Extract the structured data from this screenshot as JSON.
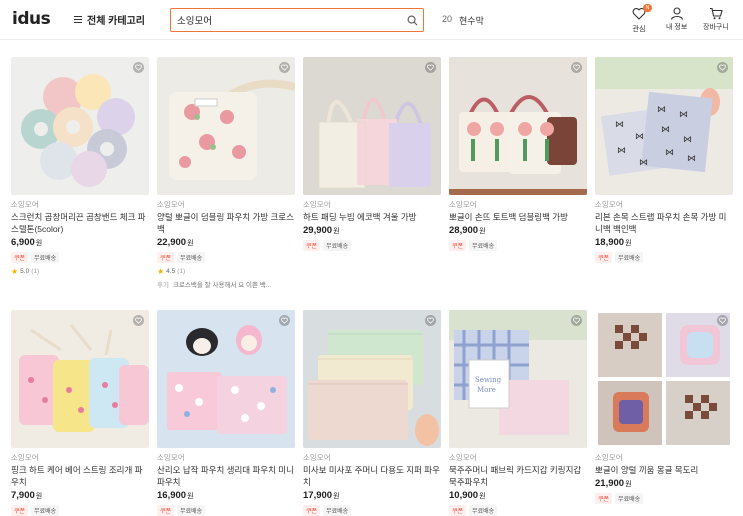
{
  "header": {
    "logo": "idus",
    "category_label": "전체 카테고리",
    "search_value": "소잉모어",
    "rank_number": "20",
    "rank_keyword": "현수막",
    "fav_label": "관심",
    "fav_badge": "N",
    "myinfo_label": "내 정보",
    "cart_label": "장바구니"
  },
  "products": [
    {
      "seller": "소잉모어",
      "title": "스크런치 곱창머리끈 곱창밴드 체크 파스텔톤(5color)",
      "price": "6,900",
      "won": "원",
      "tags": [
        "쿠폰",
        "무료배송"
      ],
      "rating": "5.0",
      "rating_count": "(1)"
    },
    {
      "seller": "소잉모어",
      "title": "양털 뽀글이 덤블링 파우치 가방 크로스백",
      "price": "22,900",
      "won": "원",
      "tags": [
        "쿠폰",
        "무료배송"
      ],
      "rating": "4.5",
      "rating_count": "(1)",
      "review_label": "후기",
      "review": "크로스백을 잘 사용해서 요 이쁜 백..."
    },
    {
      "seller": "소잉모어",
      "title": "하트 패딩 누빔 에코백 겨울 가방",
      "price": "29,900",
      "won": "원",
      "tags": [
        "쿠폰",
        "무료배송"
      ]
    },
    {
      "seller": "소잉모어",
      "title": "뽀글이 손뜨 토트백 덤블링백 가방",
      "price": "28,900",
      "won": "원",
      "tags": [
        "쿠폰",
        "무료배송"
      ]
    },
    {
      "seller": "소잉모어",
      "title": "리본 손목 스트랩 파우치 손목 가방 미니백 백인백",
      "price": "18,900",
      "won": "원",
      "tags": [
        "쿠폰",
        "무료배송"
      ]
    },
    {
      "seller": "소잉모어",
      "title": "핑크 하트 케어 베어 스트링 조리개 파우치",
      "price": "7,900",
      "won": "원",
      "tags": [
        "쿠폰",
        "무료배송"
      ]
    },
    {
      "seller": "소잉모어",
      "title": "산리오 납작 파우치 생리대 파우치 미니파우치",
      "price": "16,900",
      "won": "원",
      "tags": [
        "쿠폰",
        "무료배송"
      ]
    },
    {
      "seller": "소잉모어",
      "title": "미사보 미사포 주머니 다용도 지퍼 파우치",
      "price": "17,900",
      "won": "원",
      "tags": [
        "쿠폰",
        "무료배송"
      ]
    },
    {
      "seller": "소잉모어",
      "title": "묵주주머니 패브릭 카드지갑 키링지갑 묵주파우치",
      "price": "10,900",
      "won": "원",
      "tags": [
        "쿠폰",
        "무료배송"
      ]
    },
    {
      "seller": "소잉모어",
      "title": "뽀글이 양털 끼움 몽글 목도리",
      "price": "21,900",
      "won": "원",
      "tags": [
        "쿠폰",
        "무료배송"
      ]
    }
  ],
  "colors": {
    "accent": "#f0743a",
    "coupon": "#f04b3a",
    "star": "#f5b400"
  }
}
